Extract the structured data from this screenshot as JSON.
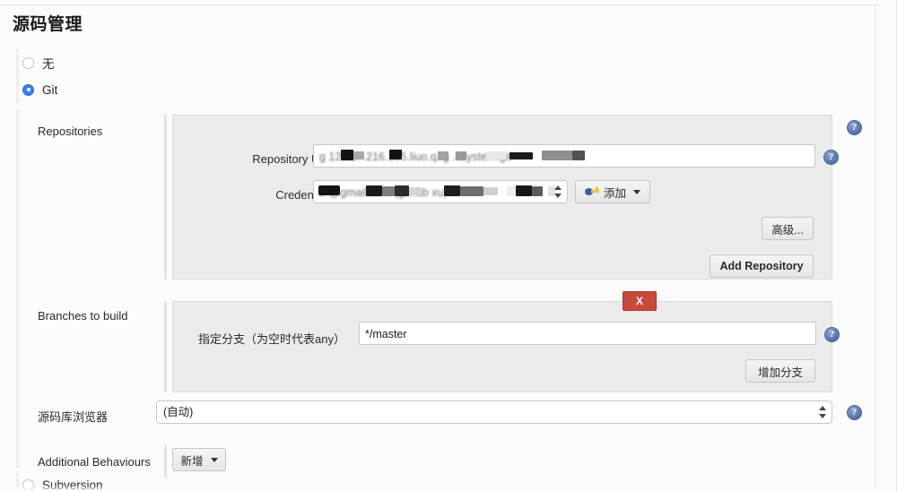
{
  "page": {
    "title": "源码管理"
  },
  "scm_options": [
    {
      "label": "无",
      "selected": false
    },
    {
      "label": "Git",
      "selected": true
    },
    {
      "label": "Subversion",
      "selected": false
    }
  ],
  "repositories": {
    "label": "Repositories",
    "repository_url": {
      "label": "Repository URL",
      "value": "g  120.27.216.155.liuo.q.      g  .ltsystem.git",
      "redacted": true
    },
    "credentials": {
      "label": "Credentials",
      "value": "        b    @gmail.com           (github  xu)  /",
      "redacted": true
    },
    "add_credentials_button": "添加",
    "advanced_button": "高级...",
    "add_repository_button": "Add Repository"
  },
  "branches": {
    "label": "Branches to build",
    "branch_specifier": {
      "label": "指定分支（为空时代表any）",
      "value": "*/master"
    },
    "delete_button": "X",
    "add_branch_button": "增加分支"
  },
  "repo_browser": {
    "label": "源码库浏览器",
    "value": "(自动)"
  },
  "additional_behaviours": {
    "label": "Additional Behaviours",
    "add_button": "新增"
  },
  "help_icon_glyph": "?",
  "colors": {
    "accent_radio": "#3b7ef3",
    "danger": "#c9483c",
    "help_icon": "#4a6a9e",
    "panel_bg": "#ebebeb",
    "page_bg": "#fbfbfb"
  }
}
